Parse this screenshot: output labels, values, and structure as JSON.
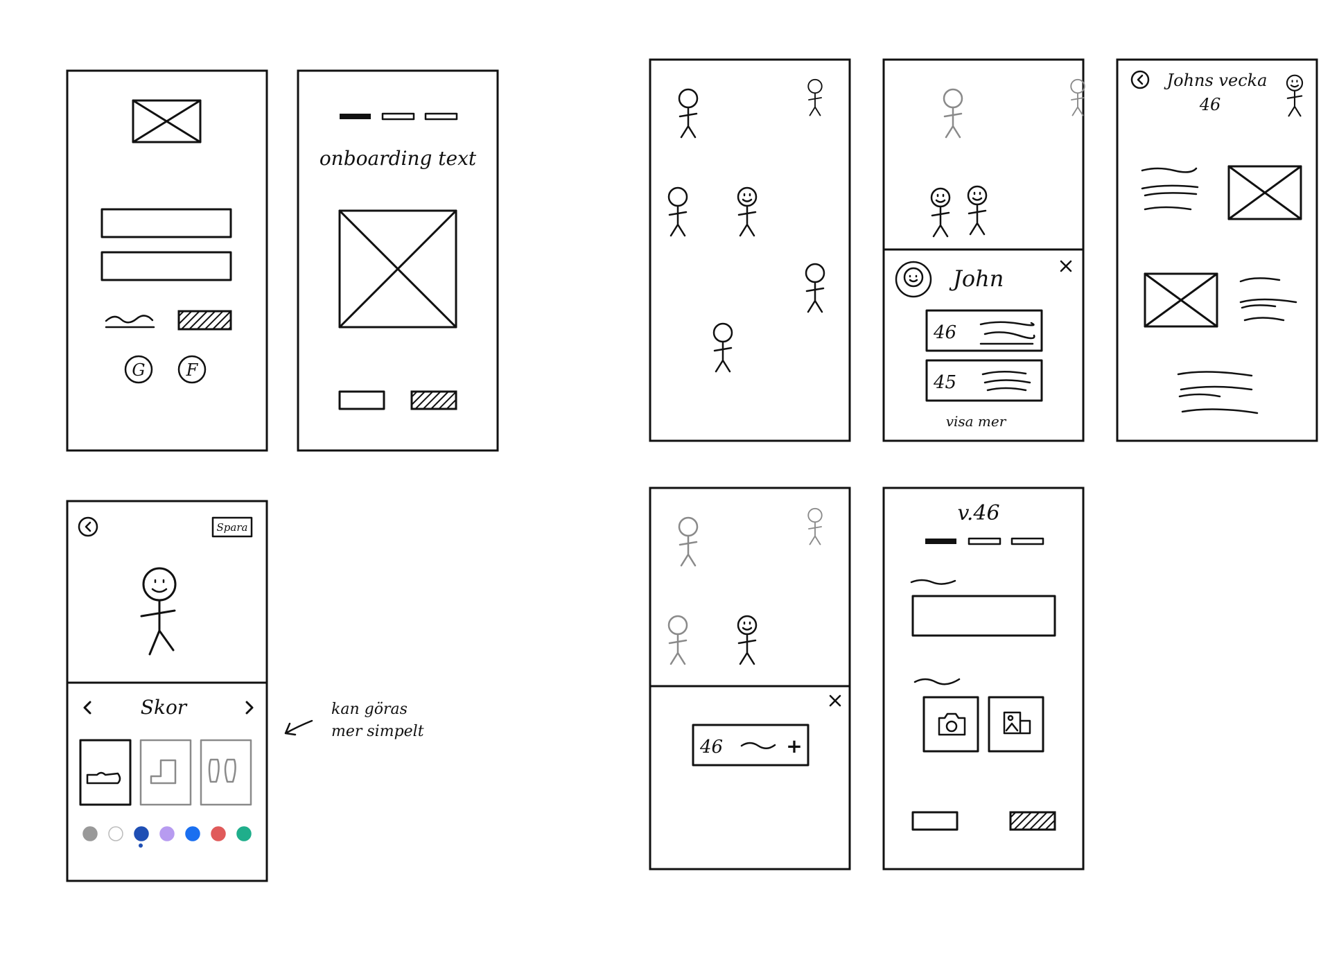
{
  "onboarding": {
    "text": "onboarding text"
  },
  "profile": {
    "name": "John",
    "week_1": "46",
    "week_2": "45",
    "more_link": "visa mer"
  },
  "johns_week": {
    "title": "Johns vecka",
    "week": "46"
  },
  "editor": {
    "save": "Spara",
    "category": "Skor",
    "note": "kan göras mer simpelt"
  },
  "quick_add": {
    "week": "46",
    "plus": "+"
  },
  "weekly_form": {
    "title": "v.46"
  },
  "palette": [
    "#999999",
    "#ffffff",
    "#1f4fb4",
    "#b79bf0",
    "#1a6ff0",
    "#e05a5a",
    "#1fae8b"
  ],
  "social": {
    "google": "G",
    "facebook": "F"
  }
}
